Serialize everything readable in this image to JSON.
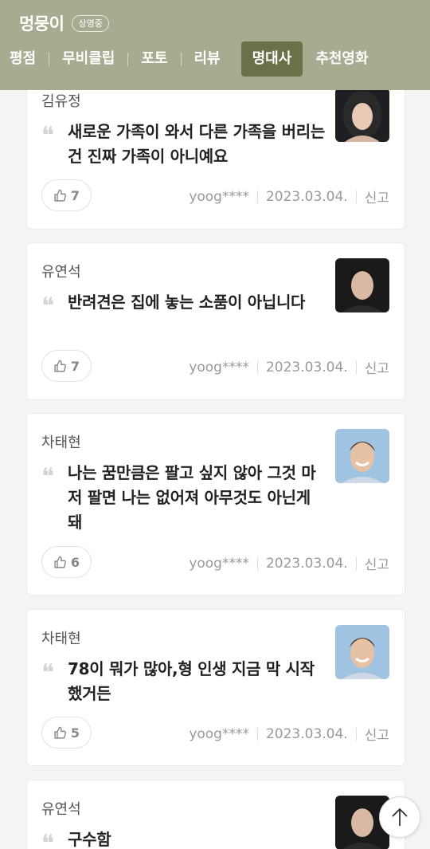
{
  "header": {
    "title": "멍뭉이",
    "badge": "상영중",
    "tabs": [
      {
        "label": "평점"
      },
      {
        "label": "무비클립"
      },
      {
        "label": "포토"
      },
      {
        "label": "리뷰"
      },
      {
        "label": "명대사",
        "active": true
      },
      {
        "label": "추천영화"
      }
    ],
    "colors": {
      "bar": "#a9ab91",
      "active_tab": "#6c7049"
    }
  },
  "lines": [
    {
      "actor": "김유정",
      "avatar": "actress-photo",
      "quote": "새로운 가족이 와서 다른 가족을 버리는 건 진짜 가족이 아니예요",
      "likes": "7",
      "user": "yoog****",
      "date": "2023.03.04.",
      "report": "신고"
    },
    {
      "actor": "유연석",
      "avatar": "actor-photo",
      "quote": "반려견은 집에 놓는 소품이 아닙니다",
      "likes": "7",
      "user": "yoog****",
      "date": "2023.03.04.",
      "report": "신고"
    },
    {
      "actor": "차태현",
      "avatar": "actor-photo",
      "quote": "나는 꿈만큼은 팔고 싶지 않아 그것 마저 팔면 나는 없어져 아무것도 아닌게 돼",
      "likes": "6",
      "user": "yoog****",
      "date": "2023.03.04.",
      "report": "신고"
    },
    {
      "actor": "차태현",
      "avatar": "actor-photo",
      "quote": "78이 뭐가 많아,형 인생 지금 막 시작했거든",
      "likes": "5",
      "user": "yoog****",
      "date": "2023.03.04.",
      "report": "신고"
    },
    {
      "actor": "유연석",
      "avatar": "actor-photo",
      "quote": "구수함",
      "likes": "",
      "user": "",
      "date": "",
      "report": ""
    }
  ],
  "icons": {
    "like": "thumbs-up-icon",
    "quote": "quote-mark-icon",
    "top": "arrow-up-icon"
  }
}
